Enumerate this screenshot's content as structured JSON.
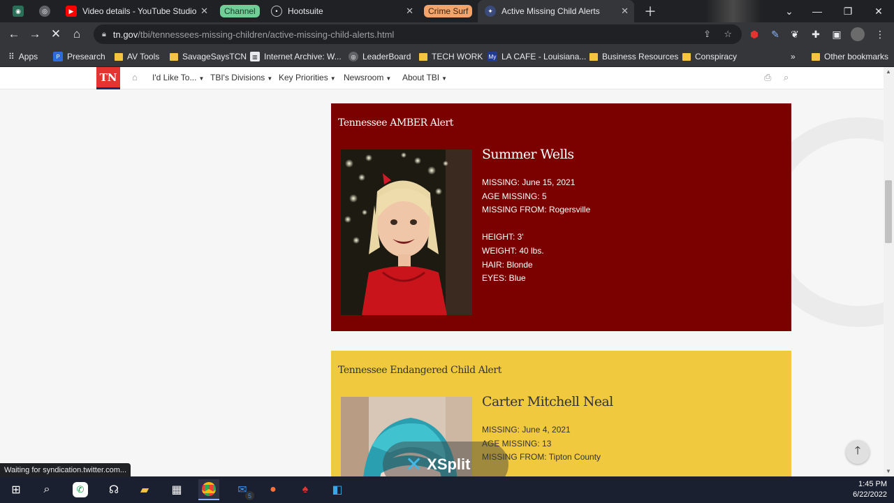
{
  "browser": {
    "tabs": [
      {
        "label": "Video details - YouTube Studio"
      },
      {
        "label": "Hootsuite"
      },
      {
        "label": "Active Missing Child Alerts"
      }
    ],
    "tab_groups": [
      {
        "label": "Channel",
        "color": "#6fcf97"
      },
      {
        "label": "Crime Surf",
        "color": "#f2a46b"
      }
    ],
    "url_host": "tn.gov",
    "url_path": "/tbi/tennessees-missing-children/active-missing-child-alerts.html",
    "bookmarks": [
      {
        "label": "Apps"
      },
      {
        "label": "Presearch"
      },
      {
        "label": "AV Tools"
      },
      {
        "label": "SavageSaysTCN"
      },
      {
        "label": "Internet Archive: W..."
      },
      {
        "label": "LeaderBoard"
      },
      {
        "label": "TECH WORK"
      },
      {
        "label": "LA CAFE - Louisiana..."
      },
      {
        "label": "Business Resources"
      },
      {
        "label": "Conspiracy"
      },
      {
        "label": "Other bookmarks"
      }
    ],
    "bookmark_overflow": "»",
    "status_text": "Waiting for syndication.twitter.com..."
  },
  "site": {
    "logo": "TN",
    "nav": [
      {
        "label": "I'd Like To..."
      },
      {
        "label": "TBI's Divisions"
      },
      {
        "label": "Key Priorities"
      },
      {
        "label": "Newsroom"
      },
      {
        "label": "About TBI"
      }
    ]
  },
  "alerts": [
    {
      "type": "Tennessee AMBER Alert",
      "bg": "#7b0000",
      "fg": "#ffffff",
      "name": "Summer Wells",
      "missing": "MISSING: June 15, 2021",
      "age": "AGE MISSING: 5",
      "from": "MISSING FROM: Rogersville",
      "height": "HEIGHT: 3'",
      "weight": "WEIGHT: 40 lbs.",
      "hair": "HAIR: Blonde",
      "eyes": "EYES: Blue"
    },
    {
      "type": "Tennessee Endangered Child Alert",
      "bg": "#f0c93e",
      "fg": "#333333",
      "name": "Carter Mitchell Neal",
      "missing": "MISSING: June 4, 2021",
      "age": "AGE MISSING: 13",
      "from": "MISSING FROM: Tipton County"
    }
  ],
  "overlay": {
    "xsplit": "XSplit"
  },
  "taskbar": {
    "time": "1:45 PM",
    "date": "6/22/2022",
    "mail_badge": "5"
  }
}
